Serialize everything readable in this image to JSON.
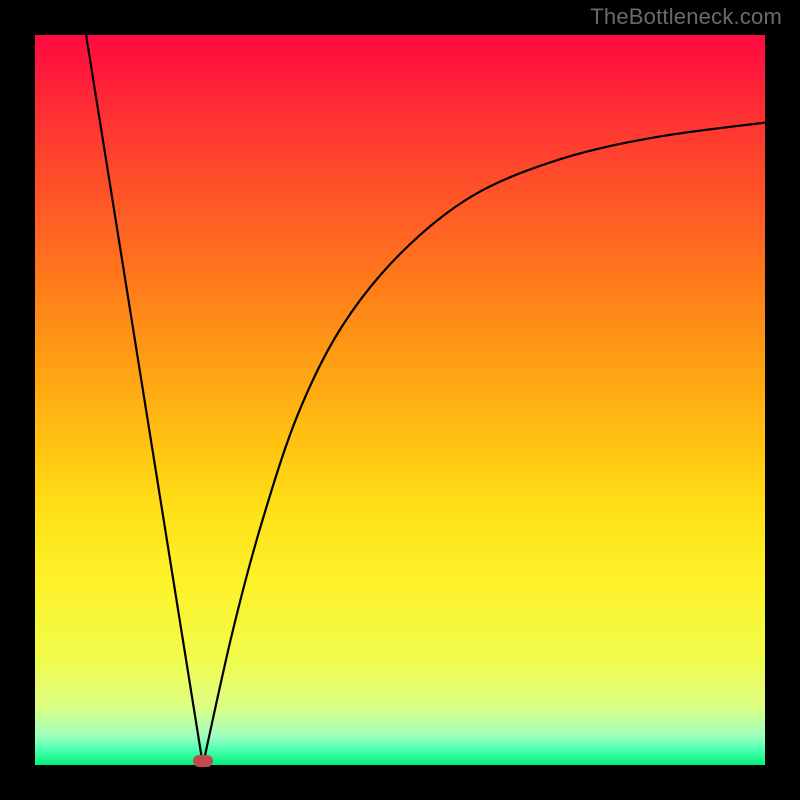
{
  "watermark": "TheBottleneck.com",
  "colors": {
    "gradient_top": "#ff0a40",
    "gradient_bottom": "#00f07a",
    "curve_stroke": "#000000",
    "marker_fill": "#c24a4f",
    "frame_bg": "#000000",
    "watermark_text": "#6a6a6a"
  },
  "chart_data": {
    "type": "line",
    "title": "",
    "xlabel": "",
    "ylabel": "",
    "xlim": [
      0,
      100
    ],
    "ylim": [
      0,
      100
    ],
    "grid": false,
    "legend": false,
    "annotations": [
      {
        "kind": "min-marker",
        "x": 23,
        "y": 0
      }
    ],
    "series": [
      {
        "name": "bottleneck-curve",
        "segment": "left-descent",
        "x": [
          7,
          23
        ],
        "y": [
          100,
          0
        ]
      },
      {
        "name": "bottleneck-curve",
        "segment": "right-ascent",
        "x": [
          23,
          27,
          31,
          36,
          42,
          50,
          60,
          72,
          85,
          100
        ],
        "y": [
          0,
          18,
          33,
          48,
          60,
          70,
          78,
          83,
          86,
          88
        ]
      }
    ],
    "background": "vertical-gradient-red-to-green"
  }
}
